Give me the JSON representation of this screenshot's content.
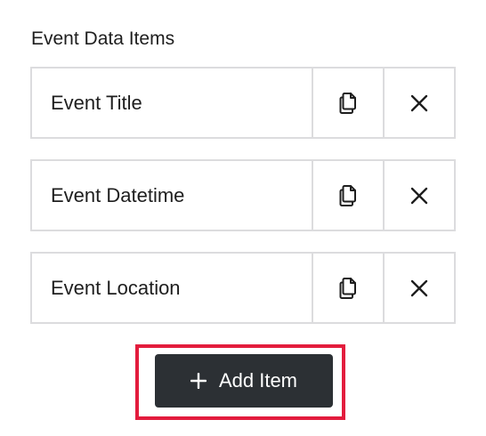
{
  "section": {
    "label": "Event Data Items"
  },
  "items": [
    {
      "label": "Event Title",
      "duplicate_icon": "copy-icon",
      "remove_icon": "close-icon"
    },
    {
      "label": "Event Datetime",
      "duplicate_icon": "copy-icon",
      "remove_icon": "close-icon"
    },
    {
      "label": "Event Location",
      "duplicate_icon": "copy-icon",
      "remove_icon": "close-icon"
    }
  ],
  "add_button": {
    "label": "Add Item",
    "icon": "plus-icon",
    "background": "#2c3034",
    "highlight_color": "#e31c3d"
  },
  "colors": {
    "border": "#dcdcde",
    "text": "#1e1e1e"
  }
}
